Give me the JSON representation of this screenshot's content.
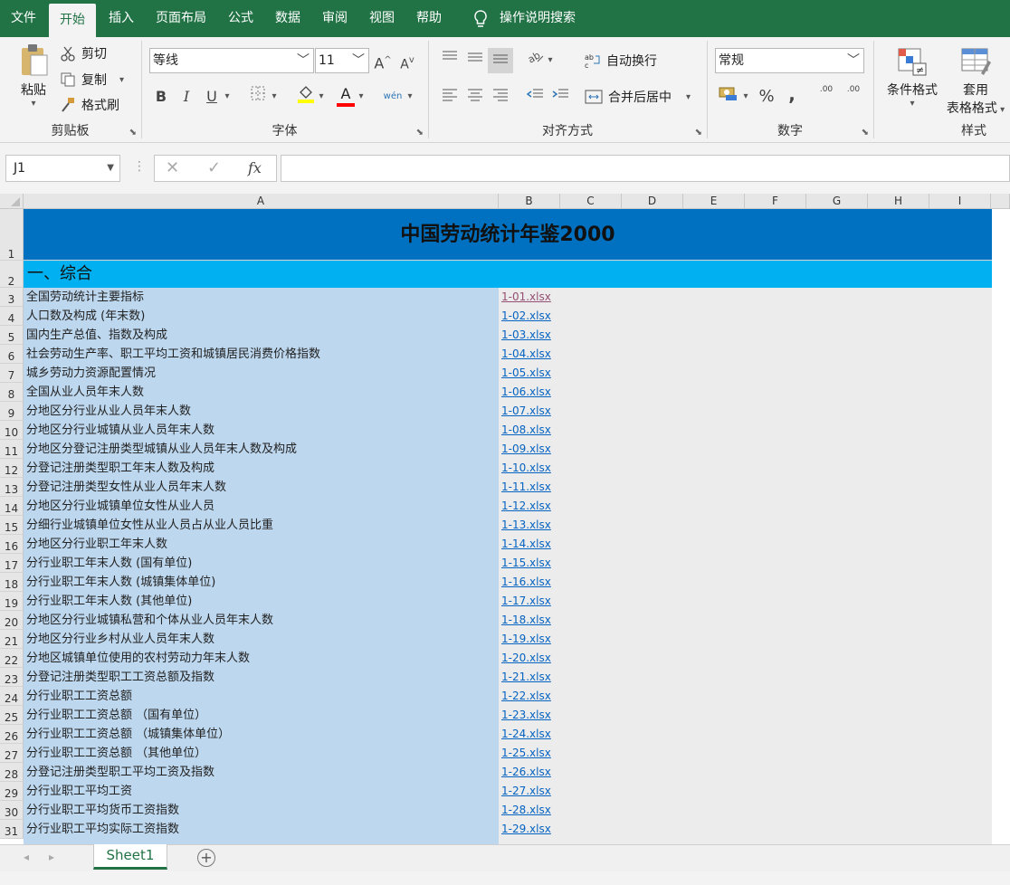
{
  "menu": {
    "tabs": [
      "文件",
      "开始",
      "插入",
      "页面布局",
      "公式",
      "数据",
      "审阅",
      "视图",
      "帮助"
    ],
    "active": "开始",
    "tell_me": "操作说明搜索"
  },
  "ribbon": {
    "clipboard": {
      "paste": "粘贴",
      "cut": "剪切",
      "copy": "复制",
      "painter": "格式刷",
      "label": "剪贴板"
    },
    "font": {
      "name": "等线",
      "size": "11",
      "grow": "A",
      "shrink": "A",
      "bold": "B",
      "italic": "I",
      "underline": "U",
      "font_color": "A",
      "phonetic": "wén",
      "label": "字体"
    },
    "align": {
      "wrap": "自动换行",
      "merge": "合并后居中",
      "label": "对齐方式"
    },
    "number": {
      "format": "常规",
      "percent": "%",
      "comma": ",",
      "inc_decimal": ".00",
      "dec_decimal": ".00",
      "label": "数字"
    },
    "styles": {
      "conditional": "条件格式",
      "table_1": "套用",
      "table_2": "表格格式",
      "label": "样式"
    }
  },
  "formula_bar": {
    "name_box": "J1",
    "cancel": "✕",
    "enter": "✓",
    "fx": "fx",
    "value": ""
  },
  "columns": [
    "A",
    "B",
    "C",
    "D",
    "E",
    "F",
    "G",
    "H",
    "I"
  ],
  "sheet": {
    "title": "中国劳动统计年鉴2000",
    "section": "一、综合",
    "rows": [
      {
        "n": "3",
        "a": "全国劳动统计主要指标",
        "b": "1-01.xlsx",
        "visited": true
      },
      {
        "n": "4",
        "a": "人口数及构成 (年末数)",
        "b": "1-02.xlsx"
      },
      {
        "n": "5",
        "a": "国内生产总值、指数及构成",
        "b": "1-03.xlsx"
      },
      {
        "n": "6",
        "a": "社会劳动生产率、职工平均工资和城镇居民消费价格指数",
        "b": "1-04.xlsx"
      },
      {
        "n": "7",
        "a": "城乡劳动力资源配置情况",
        "b": "1-05.xlsx"
      },
      {
        "n": "8",
        "a": "全国从业人员年末人数",
        "b": "1-06.xlsx"
      },
      {
        "n": "9",
        "a": "分地区分行业从业人员年末人数",
        "b": "1-07.xlsx"
      },
      {
        "n": "10",
        "a": "分地区分行业城镇从业人员年末人数",
        "b": "1-08.xlsx"
      },
      {
        "n": "11",
        "a": "分地区分登记注册类型城镇从业人员年末人数及构成",
        "b": "1-09.xlsx"
      },
      {
        "n": "12",
        "a": "分登记注册类型职工年末人数及构成",
        "b": "1-10.xlsx"
      },
      {
        "n": "13",
        "a": "分登记注册类型女性从业人员年末人数",
        "b": "1-11.xlsx"
      },
      {
        "n": "14",
        "a": "分地区分行业城镇单位女性从业人员",
        "b": "1-12.xlsx"
      },
      {
        "n": "15",
        "a": "分细行业城镇单位女性从业人员占从业人员比重",
        "b": "1-13.xlsx"
      },
      {
        "n": "16",
        "a": "分地区分行业职工年末人数",
        "b": "1-14.xlsx"
      },
      {
        "n": "17",
        "a": "分行业职工年末人数 (国有单位)",
        "b": "1-15.xlsx"
      },
      {
        "n": "18",
        "a": "分行业职工年末人数 (城镇集体单位)",
        "b": "1-16.xlsx"
      },
      {
        "n": "19",
        "a": "分行业职工年末人数 (其他单位)",
        "b": "1-17.xlsx"
      },
      {
        "n": "20",
        "a": "分地区分行业城镇私营和个体从业人员年末人数",
        "b": "1-18.xlsx"
      },
      {
        "n": "21",
        "a": "分地区分行业乡村从业人员年末人数",
        "b": "1-19.xlsx"
      },
      {
        "n": "22",
        "a": "分地区城镇单位使用的农村劳动力年末人数",
        "b": "1-20.xlsx"
      },
      {
        "n": "23",
        "a": "分登记注册类型职工工资总额及指数",
        "b": "1-21.xlsx"
      },
      {
        "n": "24",
        "a": "分行业职工工资总额",
        "b": "1-22.xlsx"
      },
      {
        "n": "25",
        "a": "分行业职工工资总额 （国有单位）",
        "b": "1-23.xlsx"
      },
      {
        "n": "26",
        "a": "分行业职工工资总额 （城镇集体单位）",
        "b": "1-24.xlsx"
      },
      {
        "n": "27",
        "a": "分行业职工工资总额 （其他单位）",
        "b": "1-25.xlsx"
      },
      {
        "n": "28",
        "a": "分登记注册类型职工平均工资及指数",
        "b": "1-26.xlsx"
      },
      {
        "n": "29",
        "a": "分行业职工平均工资",
        "b": "1-27.xlsx"
      },
      {
        "n": "30",
        "a": "分行业职工平均货币工资指数",
        "b": "1-28.xlsx"
      },
      {
        "n": "31",
        "a": "分行业职工平均实际工资指数",
        "b": "1-29.xlsx"
      }
    ]
  },
  "tabs_bar": {
    "sheet": "Sheet1",
    "add": "+"
  },
  "colors": {
    "excel_green": "#217346",
    "title_fill": "#0070c0",
    "section_fill": "#00b0f0",
    "col_a_fill": "#bdd7ee",
    "link": "#0563c1",
    "visited_link": "#954f72"
  }
}
